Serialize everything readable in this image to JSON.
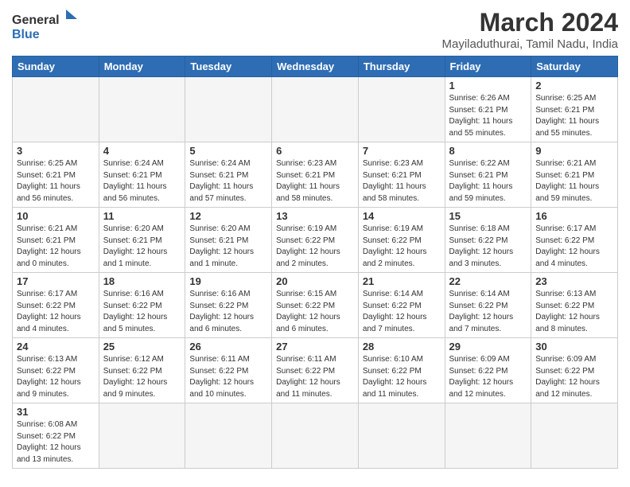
{
  "header": {
    "logo_text_general": "General",
    "logo_text_blue": "Blue",
    "month_year": "March 2024",
    "location": "Mayiladuthurai, Tamil Nadu, India"
  },
  "weekdays": [
    "Sunday",
    "Monday",
    "Tuesday",
    "Wednesday",
    "Thursday",
    "Friday",
    "Saturday"
  ],
  "weeks": [
    [
      {
        "day": "",
        "info": ""
      },
      {
        "day": "",
        "info": ""
      },
      {
        "day": "",
        "info": ""
      },
      {
        "day": "",
        "info": ""
      },
      {
        "day": "",
        "info": ""
      },
      {
        "day": "1",
        "info": "Sunrise: 6:26 AM\nSunset: 6:21 PM\nDaylight: 11 hours\nand 55 minutes."
      },
      {
        "day": "2",
        "info": "Sunrise: 6:25 AM\nSunset: 6:21 PM\nDaylight: 11 hours\nand 55 minutes."
      }
    ],
    [
      {
        "day": "3",
        "info": "Sunrise: 6:25 AM\nSunset: 6:21 PM\nDaylight: 11 hours\nand 56 minutes."
      },
      {
        "day": "4",
        "info": "Sunrise: 6:24 AM\nSunset: 6:21 PM\nDaylight: 11 hours\nand 56 minutes."
      },
      {
        "day": "5",
        "info": "Sunrise: 6:24 AM\nSunset: 6:21 PM\nDaylight: 11 hours\nand 57 minutes."
      },
      {
        "day": "6",
        "info": "Sunrise: 6:23 AM\nSunset: 6:21 PM\nDaylight: 11 hours\nand 58 minutes."
      },
      {
        "day": "7",
        "info": "Sunrise: 6:23 AM\nSunset: 6:21 PM\nDaylight: 11 hours\nand 58 minutes."
      },
      {
        "day": "8",
        "info": "Sunrise: 6:22 AM\nSunset: 6:21 PM\nDaylight: 11 hours\nand 59 minutes."
      },
      {
        "day": "9",
        "info": "Sunrise: 6:21 AM\nSunset: 6:21 PM\nDaylight: 11 hours\nand 59 minutes."
      }
    ],
    [
      {
        "day": "10",
        "info": "Sunrise: 6:21 AM\nSunset: 6:21 PM\nDaylight: 12 hours\nand 0 minutes."
      },
      {
        "day": "11",
        "info": "Sunrise: 6:20 AM\nSunset: 6:21 PM\nDaylight: 12 hours\nand 1 minute."
      },
      {
        "day": "12",
        "info": "Sunrise: 6:20 AM\nSunset: 6:21 PM\nDaylight: 12 hours\nand 1 minute."
      },
      {
        "day": "13",
        "info": "Sunrise: 6:19 AM\nSunset: 6:22 PM\nDaylight: 12 hours\nand 2 minutes."
      },
      {
        "day": "14",
        "info": "Sunrise: 6:19 AM\nSunset: 6:22 PM\nDaylight: 12 hours\nand 2 minutes."
      },
      {
        "day": "15",
        "info": "Sunrise: 6:18 AM\nSunset: 6:22 PM\nDaylight: 12 hours\nand 3 minutes."
      },
      {
        "day": "16",
        "info": "Sunrise: 6:17 AM\nSunset: 6:22 PM\nDaylight: 12 hours\nand 4 minutes."
      }
    ],
    [
      {
        "day": "17",
        "info": "Sunrise: 6:17 AM\nSunset: 6:22 PM\nDaylight: 12 hours\nand 4 minutes."
      },
      {
        "day": "18",
        "info": "Sunrise: 6:16 AM\nSunset: 6:22 PM\nDaylight: 12 hours\nand 5 minutes."
      },
      {
        "day": "19",
        "info": "Sunrise: 6:16 AM\nSunset: 6:22 PM\nDaylight: 12 hours\nand 6 minutes."
      },
      {
        "day": "20",
        "info": "Sunrise: 6:15 AM\nSunset: 6:22 PM\nDaylight: 12 hours\nand 6 minutes."
      },
      {
        "day": "21",
        "info": "Sunrise: 6:14 AM\nSunset: 6:22 PM\nDaylight: 12 hours\nand 7 minutes."
      },
      {
        "day": "22",
        "info": "Sunrise: 6:14 AM\nSunset: 6:22 PM\nDaylight: 12 hours\nand 7 minutes."
      },
      {
        "day": "23",
        "info": "Sunrise: 6:13 AM\nSunset: 6:22 PM\nDaylight: 12 hours\nand 8 minutes."
      }
    ],
    [
      {
        "day": "24",
        "info": "Sunrise: 6:13 AM\nSunset: 6:22 PM\nDaylight: 12 hours\nand 9 minutes."
      },
      {
        "day": "25",
        "info": "Sunrise: 6:12 AM\nSunset: 6:22 PM\nDaylight: 12 hours\nand 9 minutes."
      },
      {
        "day": "26",
        "info": "Sunrise: 6:11 AM\nSunset: 6:22 PM\nDaylight: 12 hours\nand 10 minutes."
      },
      {
        "day": "27",
        "info": "Sunrise: 6:11 AM\nSunset: 6:22 PM\nDaylight: 12 hours\nand 11 minutes."
      },
      {
        "day": "28",
        "info": "Sunrise: 6:10 AM\nSunset: 6:22 PM\nDaylight: 12 hours\nand 11 minutes."
      },
      {
        "day": "29",
        "info": "Sunrise: 6:09 AM\nSunset: 6:22 PM\nDaylight: 12 hours\nand 12 minutes."
      },
      {
        "day": "30",
        "info": "Sunrise: 6:09 AM\nSunset: 6:22 PM\nDaylight: 12 hours\nand 12 minutes."
      }
    ],
    [
      {
        "day": "31",
        "info": "Sunrise: 6:08 AM\nSunset: 6:22 PM\nDaylight: 12 hours\nand 13 minutes."
      },
      {
        "day": "",
        "info": ""
      },
      {
        "day": "",
        "info": ""
      },
      {
        "day": "",
        "info": ""
      },
      {
        "day": "",
        "info": ""
      },
      {
        "day": "",
        "info": ""
      },
      {
        "day": "",
        "info": ""
      }
    ]
  ]
}
